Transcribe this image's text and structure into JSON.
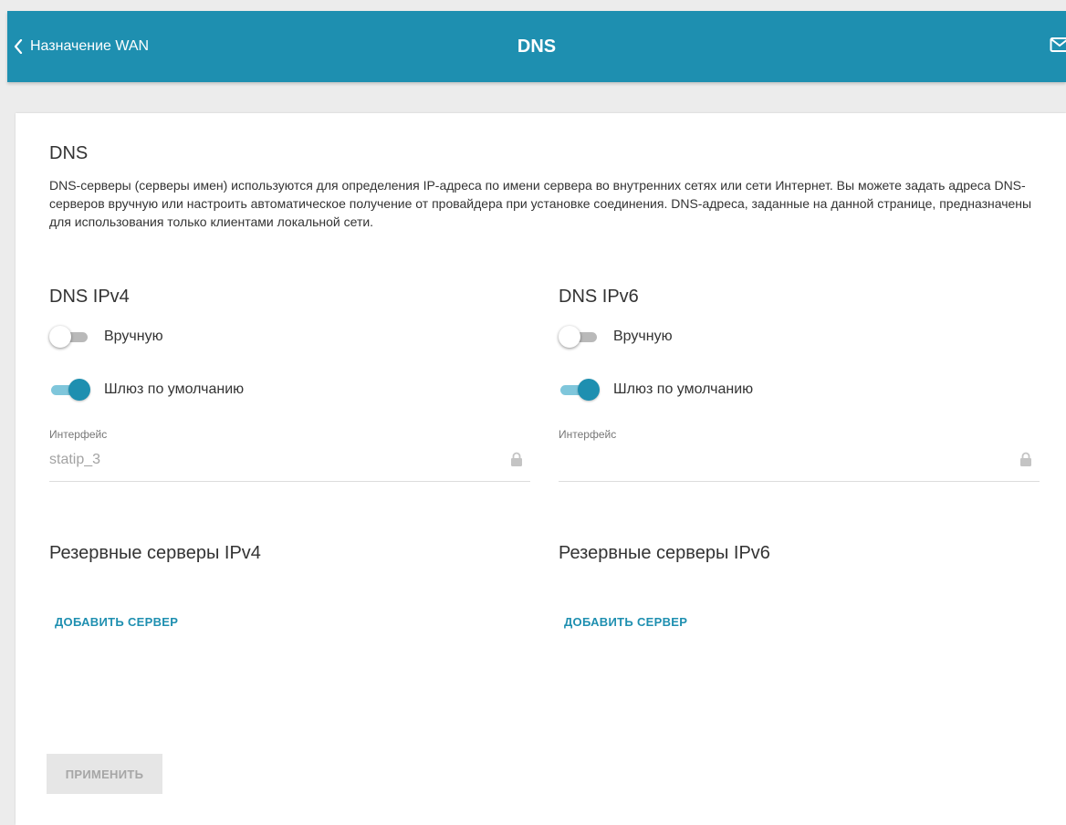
{
  "header": {
    "back_label": "Назначение WAN",
    "title": "DNS",
    "icons": {
      "back": "chevron-left-icon",
      "mail": "envelope-icon"
    },
    "colors": {
      "bar": "#1e8fb0",
      "text": "#ffffff"
    }
  },
  "card": {
    "title": "DNS",
    "description": "DNS-серверы (серверы имен) используются для определения IP-адреса по имени сервера во внутренних сетях или сети Интернет. Вы можете задать адреса DNS-серверов вручную или настроить автоматическое получение от провайдера при установке соединения. DNS-адреса, заданные на данной странице, предназначены для использования только клиентами локальной сети."
  },
  "ipv4": {
    "title": "DNS IPv4",
    "manual": {
      "label": "Вручную",
      "enabled": false
    },
    "default_gateway": {
      "label": "Шлюз по умолчанию",
      "enabled": true
    },
    "interface": {
      "label": "Интерфейс",
      "value": "statip_3",
      "locked": true
    },
    "backup_title": "Резервные серверы IPv4",
    "add_server_label": "ДОБАВИТЬ СЕРВЕР"
  },
  "ipv6": {
    "title": "DNS IPv6",
    "manual": {
      "label": "Вручную",
      "enabled": false
    },
    "default_gateway": {
      "label": "Шлюз по умолчанию",
      "enabled": true
    },
    "interface": {
      "label": "Интерфейс",
      "value": "",
      "locked": true
    },
    "backup_title": "Резервные серверы IPv6",
    "add_server_label": "ДОБАВИТЬ СЕРВЕР"
  },
  "apply_label": "ПРИМЕНИТЬ",
  "colors": {
    "accent": "#1e8fb0",
    "toggle_on_track": "#7fc6db",
    "toggle_off_track": "#b9b9b9"
  }
}
